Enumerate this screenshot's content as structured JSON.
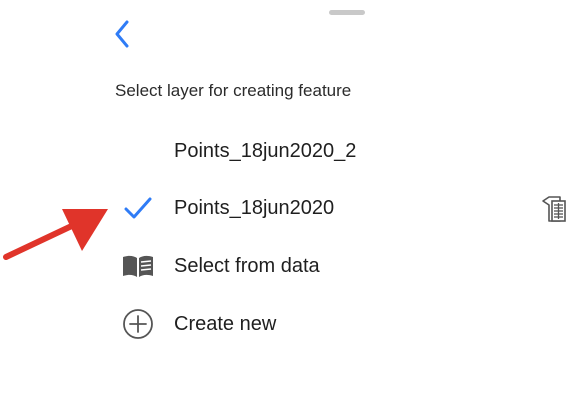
{
  "header": {
    "back_icon": "chevron-left-icon",
    "grabber": "sheet-grabber"
  },
  "prompt": {
    "subtitle": "Select layer for creating feature"
  },
  "layers": [
    {
      "label": "Points_18jun2020_2",
      "selected": false
    },
    {
      "label": "Points_18jun2020",
      "selected": true,
      "trailing_icon": "attribute-table-icon"
    }
  ],
  "actions": {
    "select_from_data": {
      "label": "Select from data",
      "icon": "book-icon"
    },
    "create_new": {
      "label": "Create new",
      "icon": "plus-circle-icon"
    }
  },
  "annotation": {
    "arrow_color": "#e0342a",
    "icon": "red-pointer-arrow"
  },
  "colors": {
    "accent": "#2f7cf6",
    "text": "#1f1f1f",
    "icon_gray": "#555555"
  }
}
